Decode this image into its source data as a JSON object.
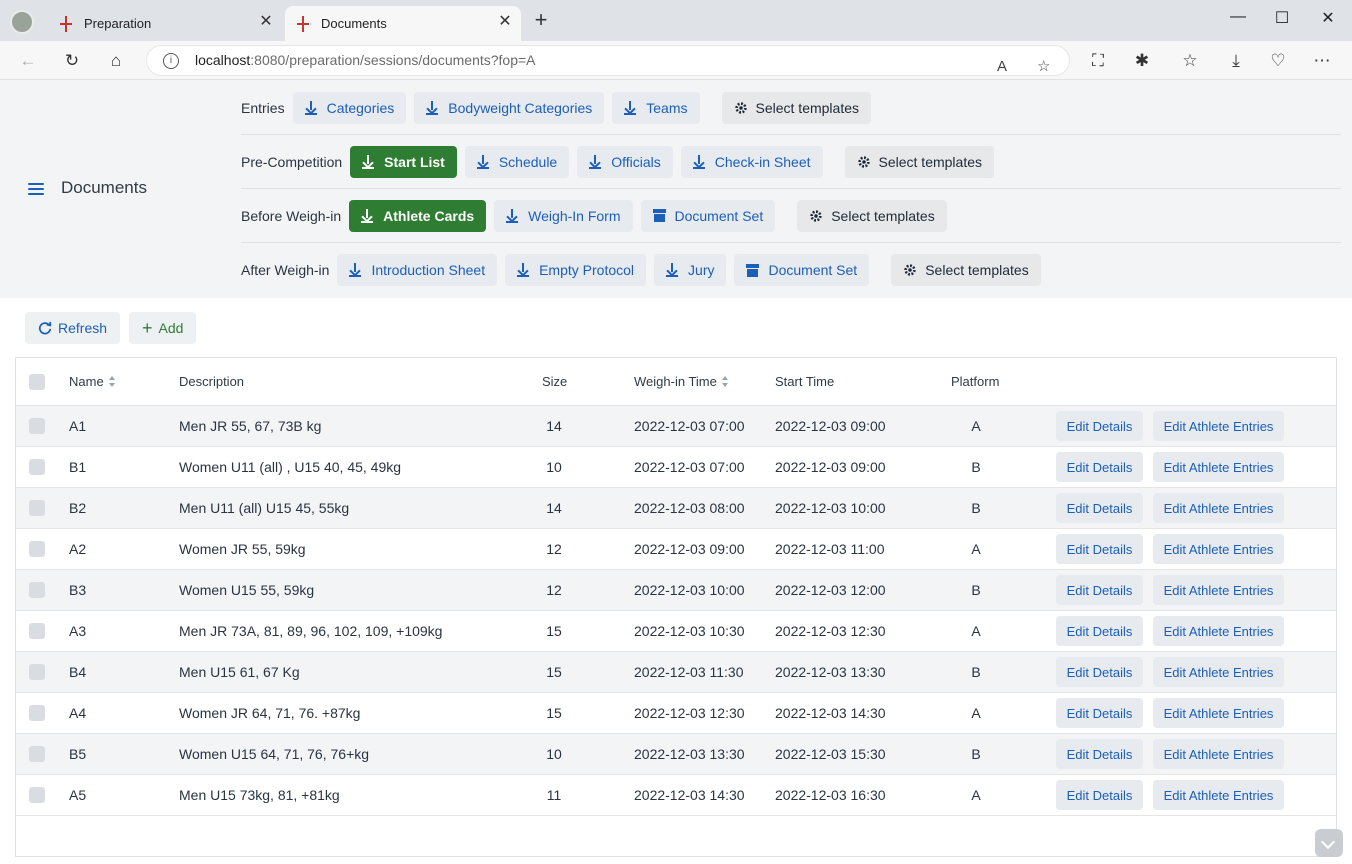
{
  "browser": {
    "tabs": [
      {
        "title": "Preparation",
        "active": false
      },
      {
        "title": "Documents",
        "active": true
      }
    ],
    "url_host": "localhost",
    "url_rest": ":8080/preparation/sessions/documents?fop=A"
  },
  "header": {
    "title": "Documents",
    "rows": [
      {
        "label": "Entries",
        "buttons": [
          {
            "text": "Categories",
            "kind": "download",
            "style": "light"
          },
          {
            "text": "Bodyweight Categories",
            "kind": "download",
            "style": "light"
          },
          {
            "text": "Teams",
            "kind": "download",
            "style": "light"
          }
        ],
        "templates": "Select templates"
      },
      {
        "label": "Pre-Competition",
        "buttons": [
          {
            "text": "Start List",
            "kind": "download",
            "style": "green"
          },
          {
            "text": "Schedule",
            "kind": "download",
            "style": "light"
          },
          {
            "text": "Officials",
            "kind": "download",
            "style": "light"
          },
          {
            "text": "Check-in Sheet",
            "kind": "download",
            "style": "light"
          }
        ],
        "templates": "Select templates"
      },
      {
        "label": "Before Weigh-in",
        "buttons": [
          {
            "text": "Athlete Cards",
            "kind": "download",
            "style": "green"
          },
          {
            "text": "Weigh-In Form",
            "kind": "download",
            "style": "light"
          },
          {
            "text": "Document Set",
            "kind": "archive",
            "style": "light"
          }
        ],
        "templates": "Select templates"
      },
      {
        "label": "After Weigh-in",
        "buttons": [
          {
            "text": "Introduction Sheet",
            "kind": "download",
            "style": "light"
          },
          {
            "text": "Empty Protocol",
            "kind": "download",
            "style": "light"
          },
          {
            "text": "Jury",
            "kind": "download",
            "style": "light"
          },
          {
            "text": "Document Set",
            "kind": "archive",
            "style": "light"
          }
        ],
        "templates": "Select templates"
      }
    ]
  },
  "toolbar": {
    "refresh": "Refresh",
    "add": "Add"
  },
  "grid": {
    "columns": {
      "name": "Name",
      "description": "Description",
      "size": "Size",
      "weighin": "Weigh-in Time",
      "start": "Start Time",
      "platform": "Platform"
    },
    "action1": "Edit Details",
    "action2": "Edit Athlete Entries",
    "rows": [
      {
        "name": "A1",
        "description": "Men JR 55, 67, 73B kg",
        "size": "14",
        "weighin": "2022-12-03 07:00",
        "start": "2022-12-03 09:00",
        "platform": "A"
      },
      {
        "name": "B1",
        "description": "Women U11 (all) , U15 40, 45, 49kg",
        "size": "10",
        "weighin": "2022-12-03 07:00",
        "start": "2022-12-03 09:00",
        "platform": "B"
      },
      {
        "name": "B2",
        "description": "Men U11 (all) U15 45, 55kg",
        "size": "14",
        "weighin": "2022-12-03 08:00",
        "start": "2022-12-03 10:00",
        "platform": "B"
      },
      {
        "name": "A2",
        "description": "Women JR 55, 59kg",
        "size": "12",
        "weighin": "2022-12-03 09:00",
        "start": "2022-12-03 11:00",
        "platform": "A"
      },
      {
        "name": "B3",
        "description": "Women U15 55, 59kg",
        "size": "12",
        "weighin": "2022-12-03 10:00",
        "start": "2022-12-03 12:00",
        "platform": "B"
      },
      {
        "name": "A3",
        "description": "Men JR 73A, 81, 89, 96, 102, 109, +109kg",
        "size": "15",
        "weighin": "2022-12-03 10:30",
        "start": "2022-12-03 12:30",
        "platform": "A"
      },
      {
        "name": "B4",
        "description": "Men U15 61, 67 Kg",
        "size": "15",
        "weighin": "2022-12-03 11:30",
        "start": "2022-12-03 13:30",
        "platform": "B"
      },
      {
        "name": "A4",
        "description": "Women JR 64, 71, 76. +87kg",
        "size": "15",
        "weighin": "2022-12-03 12:30",
        "start": "2022-12-03 14:30",
        "platform": "A"
      },
      {
        "name": "B5",
        "description": "Women U15 64, 71, 76, 76+kg",
        "size": "10",
        "weighin": "2022-12-03 13:30",
        "start": "2022-12-03 15:30",
        "platform": "B"
      },
      {
        "name": "A5",
        "description": "Men U15 73kg, 81, +81kg",
        "size": "11",
        "weighin": "2022-12-03 14:30",
        "start": "2022-12-03 16:30",
        "platform": "A"
      }
    ]
  }
}
